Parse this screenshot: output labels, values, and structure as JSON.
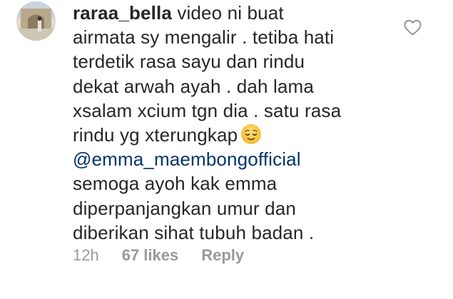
{
  "comment": {
    "username": "raraa_bella",
    "lines": [
      "video ni buat",
      "airmata sy mengalir . tetiba hati",
      "terdetik rasa sayu dan rindu",
      "dekat arwah ayah . dah lama",
      "xsalam xcium tgn dia . satu rasa",
      "rindu yg xterungkap"
    ],
    "emoji": "relieved-face",
    "mention": "@emma_maembongofficial",
    "lines_after": [
      "semoga ayoh kak emma",
      "diperpanjangkan umur dan",
      "diberikan sihat tubuh badan ."
    ]
  },
  "meta": {
    "time": "12h",
    "likes": "67 likes",
    "reply_label": "Reply"
  },
  "colors": {
    "text": "#262626",
    "mention": "#003569",
    "meta": "#999999",
    "heart_outline": "#8e8e8e"
  },
  "icons": {
    "avatar": "avatar",
    "like": "heart-icon"
  }
}
